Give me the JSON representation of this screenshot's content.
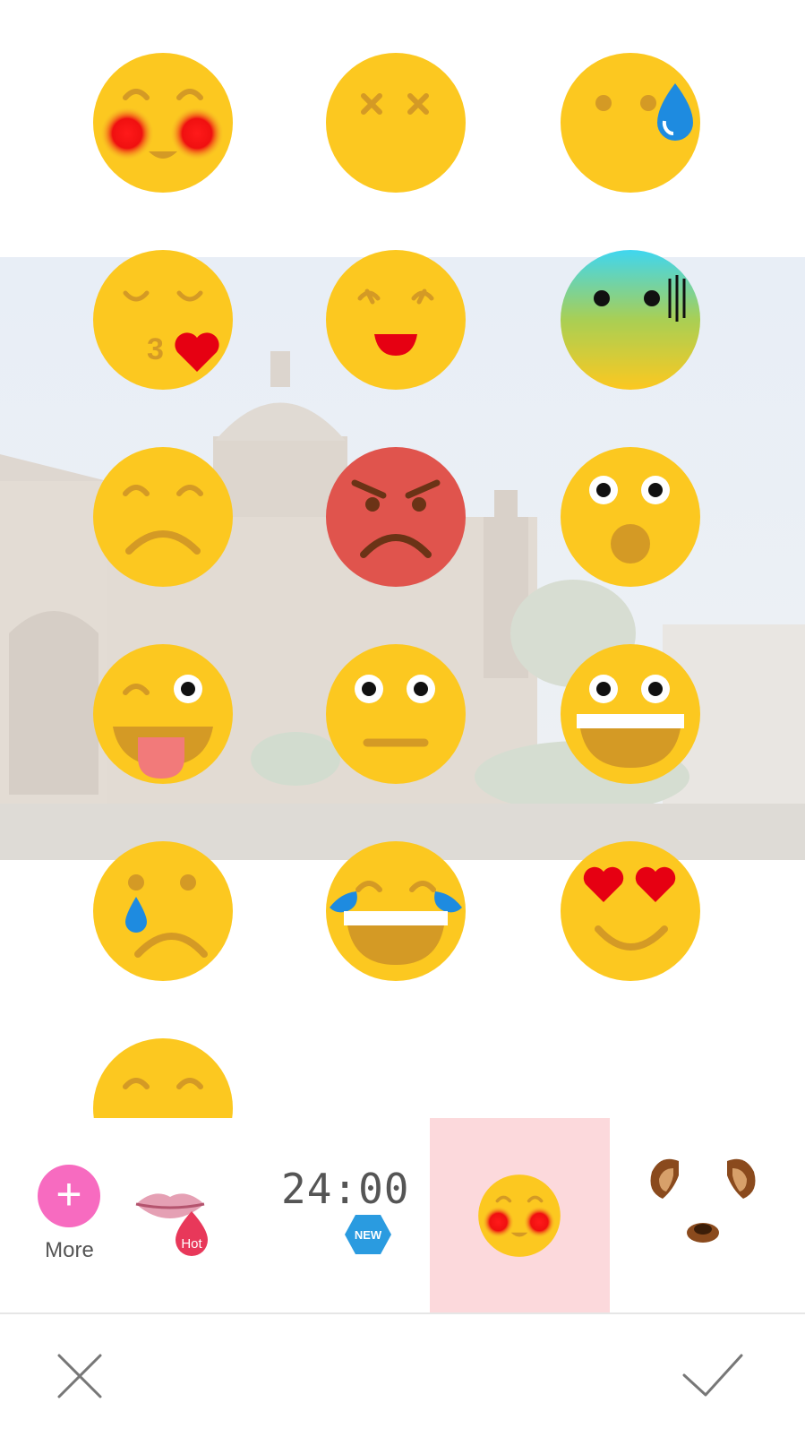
{
  "app": {
    "accent_color": "#fcd9dc",
    "more_color": "#f76bc0"
  },
  "background_photo": {
    "subject": "cathedral-photo"
  },
  "stickers": [
    {
      "name": "blushing-emoji-icon"
    },
    {
      "name": "dizzy-eyes-emoji-icon"
    },
    {
      "name": "sweat-drop-emoji-icon"
    },
    {
      "name": "kissing-heart-emoji-icon"
    },
    {
      "name": "happy-squint-emoji-icon"
    },
    {
      "name": "cold-fear-emoji-icon"
    },
    {
      "name": "sad-emoji-icon"
    },
    {
      "name": "angry-emoji-icon"
    },
    {
      "name": "surprised-emoji-icon"
    },
    {
      "name": "tongue-wink-emoji-icon"
    },
    {
      "name": "neutral-emoji-icon"
    },
    {
      "name": "grinning-emoji-icon"
    },
    {
      "name": "crying-emoji-icon"
    },
    {
      "name": "tears-of-joy-emoji-icon"
    },
    {
      "name": "heart-eyes-emoji-icon"
    },
    {
      "name": "partial-emoji-icon"
    }
  ],
  "tray": {
    "more_label": "More",
    "items": [
      {
        "name": "lips-category",
        "badge": "Hot"
      },
      {
        "name": "clock-category",
        "text": "24:00",
        "badge": "NEW"
      },
      {
        "name": "emoji-category",
        "selected": true
      },
      {
        "name": "dog-category"
      }
    ]
  },
  "bottom_bar": {
    "cancel_icon": "close-icon",
    "confirm_icon": "check-icon"
  }
}
